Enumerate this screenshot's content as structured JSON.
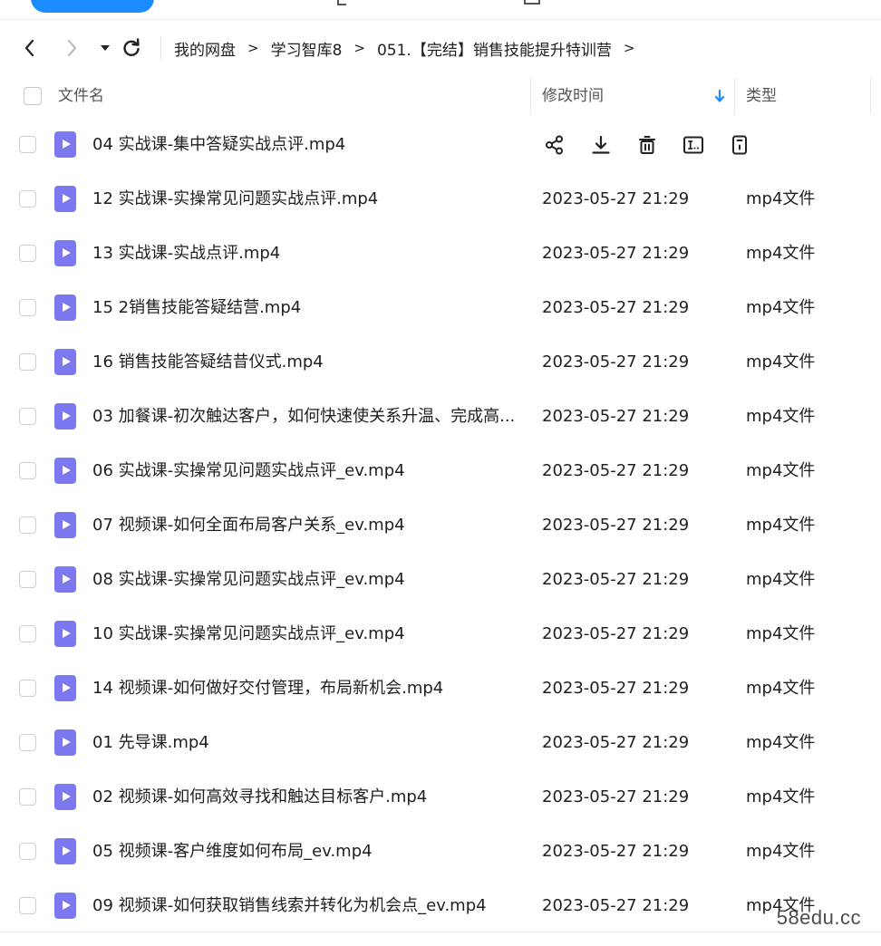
{
  "nav": {
    "back_icon": "chevron-left-icon",
    "forward_icon": "chevron-right-icon",
    "history_icon": "caret-down-icon",
    "refresh_icon": "refresh-icon",
    "breadcrumb": [
      {
        "label": "我的网盘"
      },
      {
        "label": "学习智库8"
      },
      {
        "label": "051.【完结】销售技能提升特训营"
      }
    ],
    "separator": ">"
  },
  "table": {
    "columns": {
      "name": "文件名",
      "modified": "修改时间",
      "type": "类型"
    },
    "sort_icon": "arrow-down-icon",
    "accent_color": "#1a8cff",
    "hover_actions": [
      "share-icon",
      "download-icon",
      "delete-icon",
      "rename-icon",
      "more-icon"
    ],
    "rows": [
      {
        "name": "04 实战课-集中答疑实战点评.mp4",
        "modified": "",
        "type": ""
      },
      {
        "name": "12 实战课-实操常见问题实战点评.mp4",
        "modified": "2023-05-27 21:29",
        "type": "mp4文件"
      },
      {
        "name": "13 实战课-实战点评.mp4",
        "modified": "2023-05-27 21:29",
        "type": "mp4文件"
      },
      {
        "name": "15 2销售技能答疑结营.mp4",
        "modified": "2023-05-27 21:29",
        "type": "mp4文件"
      },
      {
        "name": "16 销售技能答疑结昔仪式.mp4",
        "modified": "2023-05-27 21:29",
        "type": "mp4文件"
      },
      {
        "name": "03 加餐课-初次触达客户，如何快速使关系升温、完成高...",
        "modified": "2023-05-27 21:29",
        "type": "mp4文件"
      },
      {
        "name": "06 实战课-实操常见问题实战点评_ev.mp4",
        "modified": "2023-05-27 21:29",
        "type": "mp4文件"
      },
      {
        "name": "07 视频课-如何全面布局客户关系_ev.mp4",
        "modified": "2023-05-27 21:29",
        "type": "mp4文件"
      },
      {
        "name": "08 实战课-实操常见问题实战点评_ev.mp4",
        "modified": "2023-05-27 21:29",
        "type": "mp4文件"
      },
      {
        "name": "10 实战课-实操常见问题实战点评_ev.mp4",
        "modified": "2023-05-27 21:29",
        "type": "mp4文件"
      },
      {
        "name": "14 视频课-如何做好交付管理，布局新机会.mp4",
        "modified": "2023-05-27 21:29",
        "type": "mp4文件"
      },
      {
        "name": "01 先导课.mp4",
        "modified": "2023-05-27 21:29",
        "type": "mp4文件"
      },
      {
        "name": "02 视频课-如何高效寻找和触达目标客户.mp4",
        "modified": "2023-05-27 21:29",
        "type": "mp4文件"
      },
      {
        "name": "05 视频课-客户维度如何布局_ev.mp4",
        "modified": "2023-05-27 21:29",
        "type": "mp4文件"
      },
      {
        "name": "09 视频课-如何获取销售线索并转化为机会点_ev.mp4",
        "modified": "2023-05-27 21:29",
        "type": "mp4文件"
      }
    ]
  },
  "watermark": "58edu.cc"
}
